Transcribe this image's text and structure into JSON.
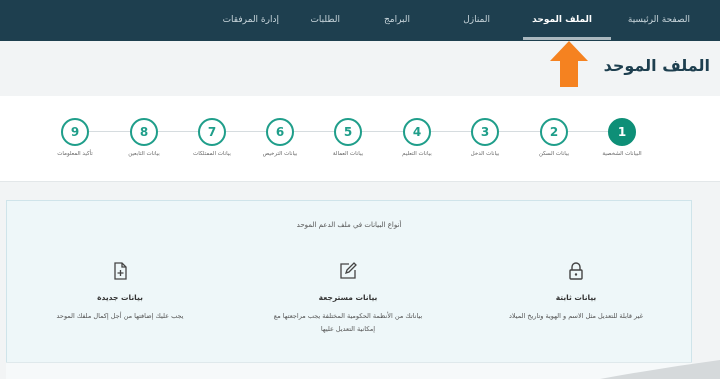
{
  "nav": {
    "items": [
      {
        "label": "الصفحة الرئيسية",
        "active": false
      },
      {
        "label": "الملف الموحد",
        "active": true
      },
      {
        "label": "المنازل",
        "active": false
      },
      {
        "label": "البرامج",
        "active": false
      },
      {
        "label": "الطلبات",
        "active": false
      },
      {
        "label": "إدارة المرفقات",
        "active": false
      }
    ]
  },
  "page": {
    "title": "الملف الموحد"
  },
  "steps": [
    {
      "number": "1",
      "label": "البيانات الشخصية",
      "active": true
    },
    {
      "number": "2",
      "label": "بيانات السكن",
      "active": false
    },
    {
      "number": "3",
      "label": "بيانات الدخل",
      "active": false
    },
    {
      "number": "4",
      "label": "بيانات التعليم",
      "active": false
    },
    {
      "number": "5",
      "label": "بيانات العمالة",
      "active": false
    },
    {
      "number": "6",
      "label": "بيانات الترخيص",
      "active": false
    },
    {
      "number": "7",
      "label": "بيانات الممتلكات",
      "active": false
    },
    {
      "number": "8",
      "label": "بيانات التابعين",
      "active": false
    },
    {
      "number": "9",
      "label": "تأكيد المعلومات",
      "active": false
    }
  ],
  "panel": {
    "title": "أنواع البيانات في ملف الدعم الموحد",
    "columns": [
      {
        "icon": "lock-icon",
        "title": "بيانات ثابتة",
        "desc": [
          "غير قابلة للتعديل مثل الاسم و الهوية وتاريخ الميلاد"
        ]
      },
      {
        "icon": "edit-icon",
        "title": "بيانات مسترجعة",
        "desc": [
          "بياناتك من الأنظمة الحكومية المختلفة يجب مراجعتها مع",
          "إمكانية التعديل عليها"
        ]
      },
      {
        "icon": "new-file-icon",
        "title": "بيانات جديدة",
        "desc": [
          "يجب عليك إضافتها من أجل إكمال ملفك الموحد"
        ]
      }
    ]
  },
  "colors": {
    "nav_bg": "#1e3f4f",
    "accent": "#0e8f77",
    "arrow": "#f58220"
  }
}
